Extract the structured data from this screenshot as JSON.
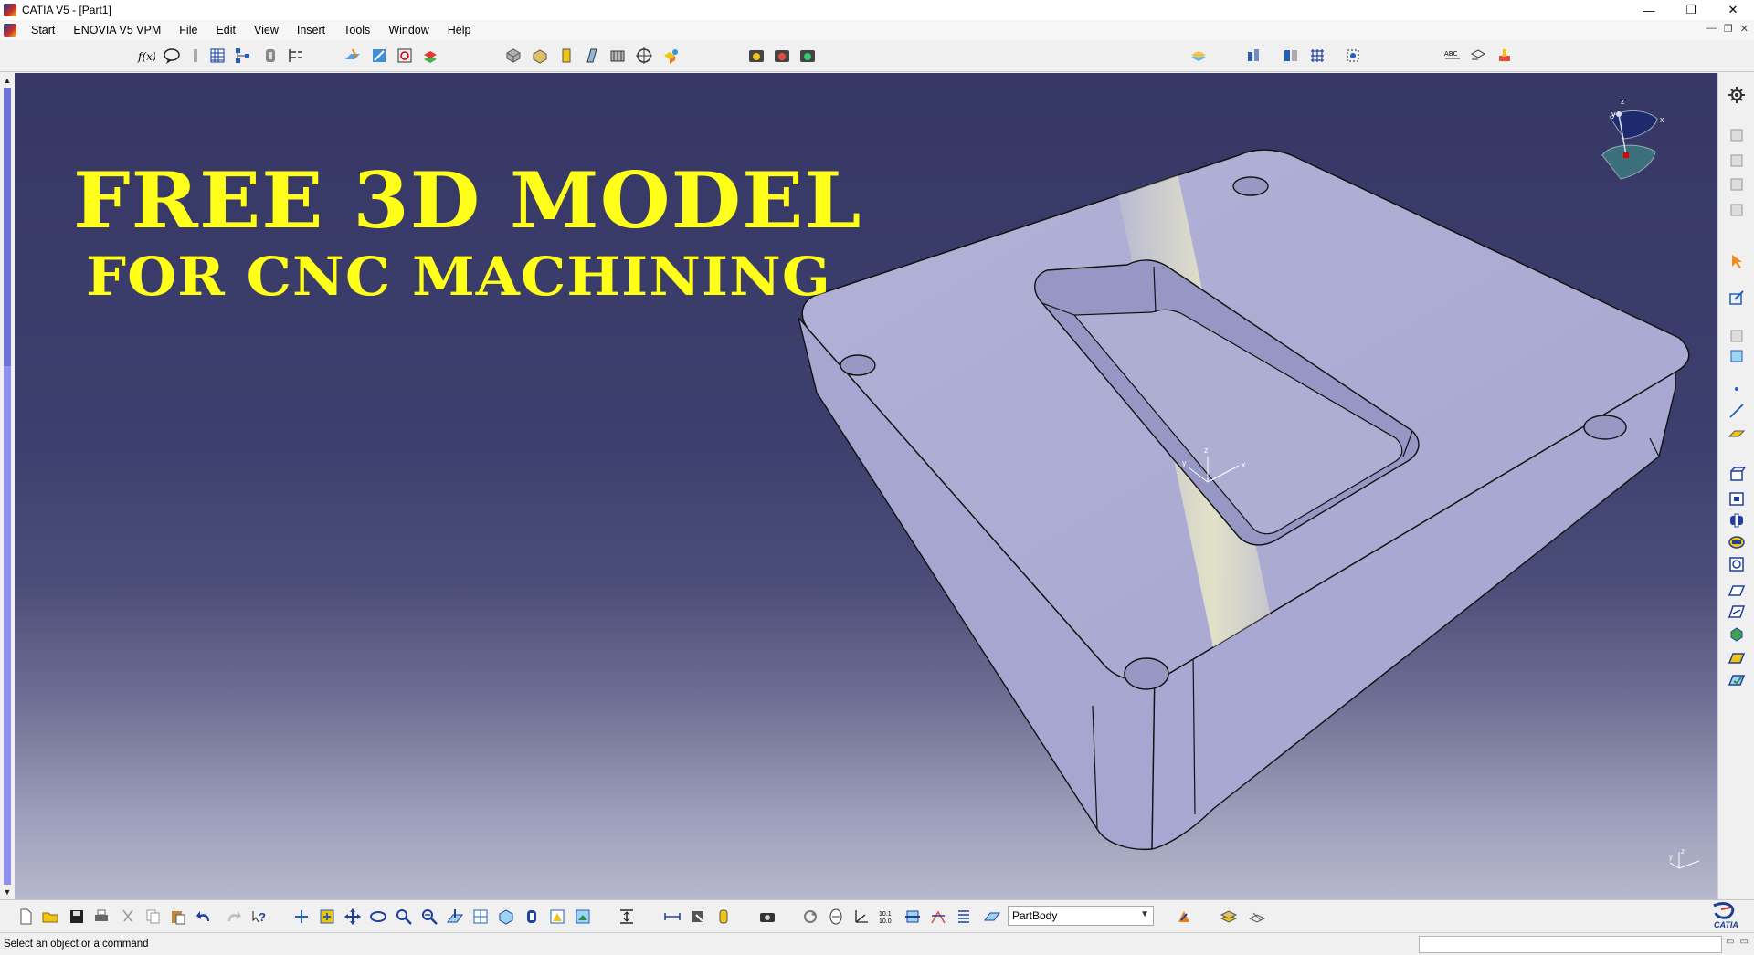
{
  "window": {
    "title": "CATIA V5 - [Part1]",
    "controls": {
      "minimize": "—",
      "restore": "❐",
      "close": "✕"
    }
  },
  "menubar": {
    "items": [
      "Start",
      "ENOVIA V5 VPM",
      "File",
      "Edit",
      "View",
      "Insert",
      "Tools",
      "Window",
      "Help"
    ]
  },
  "banner": {
    "line1": "FREE 3D MODEL",
    "line2": "FOR CNC MACHINING"
  },
  "compass": {
    "x_label": "x",
    "y_label": "y",
    "z_label": "z"
  },
  "bottom_toolbar": {
    "current_body": "PartBody",
    "logo_text": "CATIA"
  },
  "statusbar": {
    "message": "Select an object or a command"
  },
  "colors": {
    "viewport_top": "#363764",
    "viewport_bottom": "#b7b8cc",
    "banner_text": "#ffff1a",
    "part_face": "#a9a9d3",
    "part_top": "#b8b8dc",
    "highlight": "#ecebc6"
  }
}
